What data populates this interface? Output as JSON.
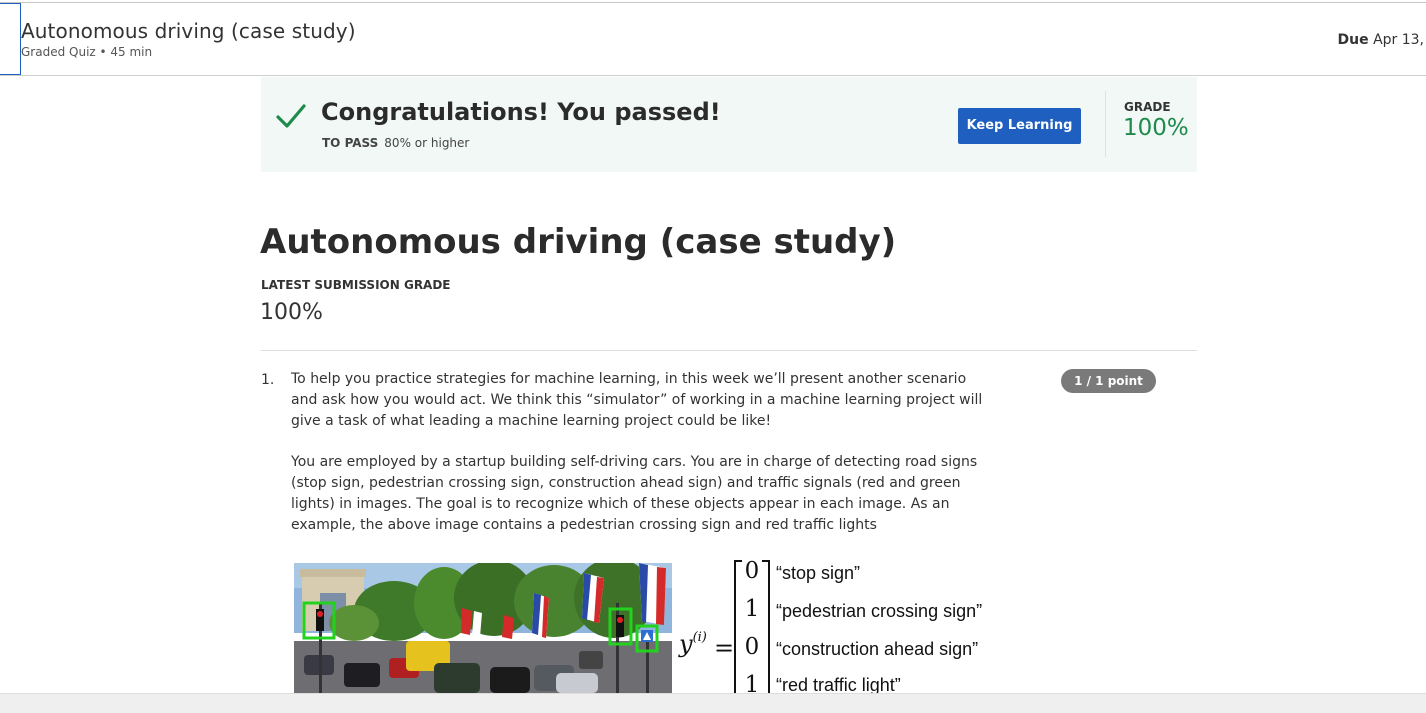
{
  "header": {
    "title": "Autonomous driving (case study)",
    "subtitle": "Graded Quiz • 45 min",
    "due_label": "Due",
    "due_value": "Apr 13,"
  },
  "banner": {
    "title": "Congratulations! You passed!",
    "to_pass_label": "TO PASS",
    "to_pass_value": "80% or higher",
    "button_label": "Keep Learning",
    "grade_label": "GRADE",
    "grade_value": "100%",
    "accent_color": "#1e8a4c",
    "button_color": "#1f5fbf"
  },
  "main": {
    "title": "Autonomous driving (case study)",
    "latest_label": "LATEST SUBMISSION GRADE",
    "latest_value": "100%"
  },
  "question": {
    "number": "1.",
    "points": "1 / 1 point",
    "paragraph1": "To help you practice strategies for machine learning, in this week we’ll present another scenario and ask how you would act. We think this “simulator” of working in a machine learning project will give a task of what leading a machine learning project could be like!",
    "paragraph2": "You are employed by a startup building self-driving cars. You are in charge of detecting road signs (stop sign, pedestrian crossing sign, construction ahead sign) and traffic signals (red and green lights) in images. The goal is to recognize which of these objects appear in each image. As an example, the above image contains a pedestrian crossing sign and red traffic lights",
    "figure": {
      "y_symbol": "y",
      "y_superscript": "(i)",
      "equals": "=",
      "vector": [
        {
          "value": "0",
          "label": "“stop sign”"
        },
        {
          "value": "1",
          "label": "“pedestrian crossing sign”"
        },
        {
          "value": "0",
          "label": "“construction ahead sign”"
        },
        {
          "value": "1",
          "label": "“red traffic light”"
        }
      ]
    }
  }
}
